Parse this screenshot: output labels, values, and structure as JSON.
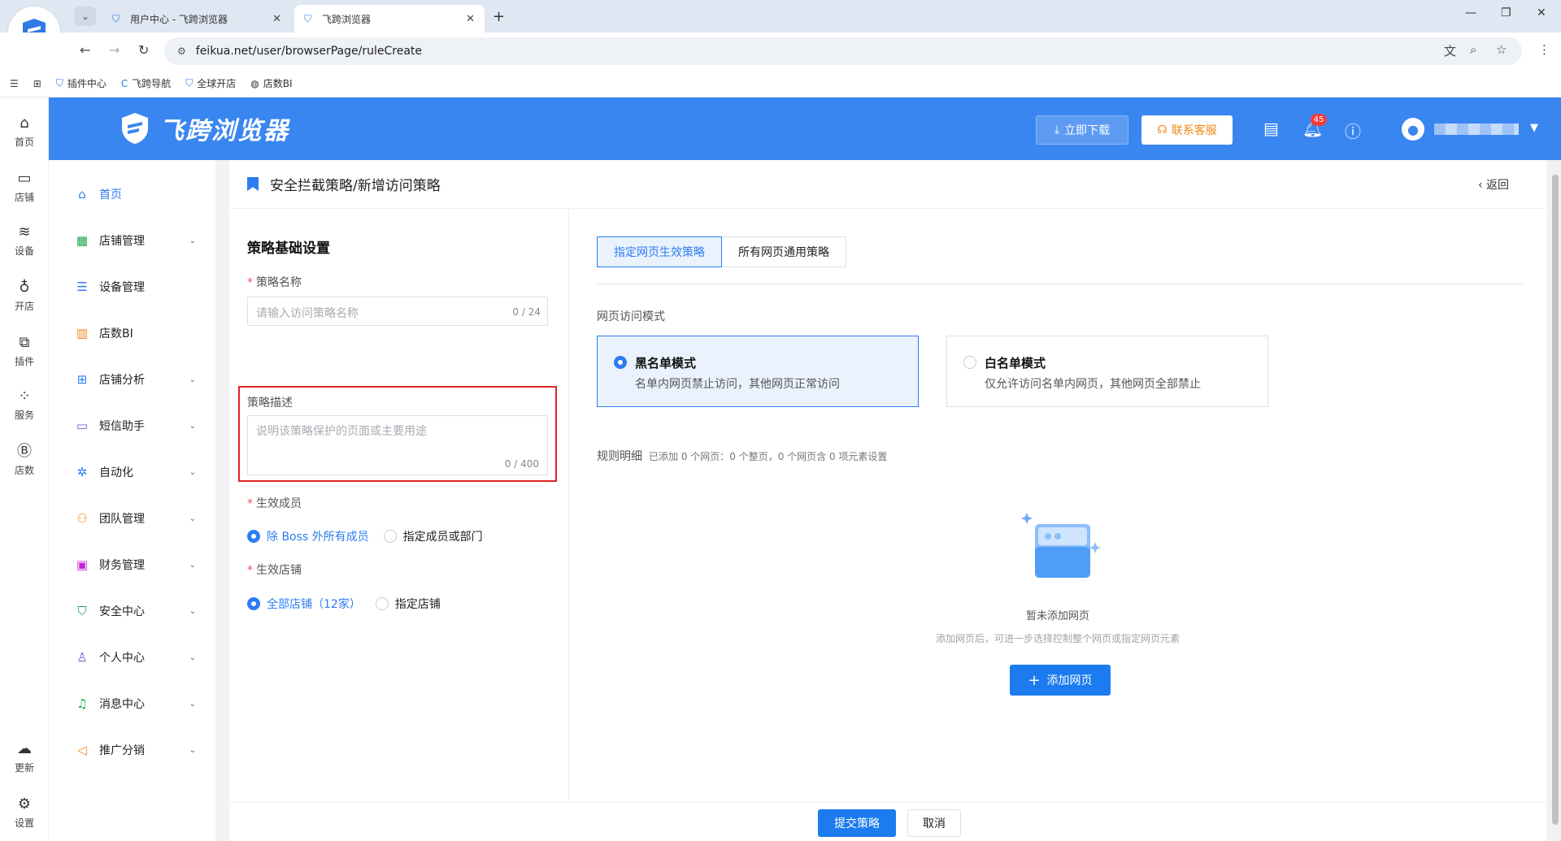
{
  "browser": {
    "tabs": [
      {
        "title": "用户中心 - 飞跨浏览器",
        "active": false
      },
      {
        "title": "飞跨浏览器",
        "active": true
      }
    ],
    "url": "feikua.net/user/browserPage/ruleCreate",
    "bookmarks": [
      "插件中心",
      "飞跨导航",
      "全球开店",
      "店数BI"
    ]
  },
  "rail": {
    "items": [
      "首页",
      "店铺",
      "设备",
      "开店",
      "插件",
      "服务",
      "店数",
      "更新",
      "设置"
    ]
  },
  "header": {
    "brand": "飞跨浏览器",
    "download_label": "立即下载",
    "support_label": "联系客服",
    "notification_count": "45"
  },
  "menu": {
    "items": [
      "首页",
      "店铺管理",
      "设备管理",
      "店数BI",
      "店铺分析",
      "短信助手",
      "自动化",
      "团队管理",
      "财务管理",
      "安全中心",
      "个人中心",
      "消息中心",
      "推广分销"
    ]
  },
  "page": {
    "title": "安全拦截策略/新增访问策略",
    "back_label": "返回"
  },
  "form": {
    "section_title": "策略基础设置",
    "name_label": "策略名称",
    "name_placeholder": "请输入访问策略名称",
    "name_count": "0 / 24",
    "desc_label": "策略描述",
    "desc_placeholder": "说明该策略保护的页面或主要用途",
    "desc_count": "0 / 400",
    "members_label": "生效成员",
    "members_opt1": "除 Boss 外所有成员",
    "members_opt2": "指定成员或部门",
    "stores_label": "生效店铺",
    "stores_opt1": "全部店铺（12家）",
    "stores_opt2": "指定店铺"
  },
  "rules": {
    "tab_specific": "指定网页生效策略",
    "tab_all": "所有网页通用策略",
    "mode_label": "网页访问模式",
    "black_title": "黑名单模式",
    "black_desc": "名单内网页禁止访问，其他网页正常访问",
    "white_title": "白名单模式",
    "white_desc": "仅允许访问名单内网页，其他网页全部禁止",
    "detail_label": "规则明细",
    "detail_summary": "已添加 0 个网页：0 个整页，0 个网页含 0 项元素设置",
    "empty_title": "暂未添加网页",
    "empty_sub": "添加网页后，可进一步选择控制整个网页或指定网页元素",
    "add_button": "添加网页"
  },
  "footer": {
    "submit_label": "提交策略",
    "cancel_label": "取消"
  },
  "colors": {
    "brand_blue": "#3a86f1",
    "primary": "#1b7bef",
    "support_orange": "#f08a1a",
    "highlight_red": "#e02424"
  }
}
